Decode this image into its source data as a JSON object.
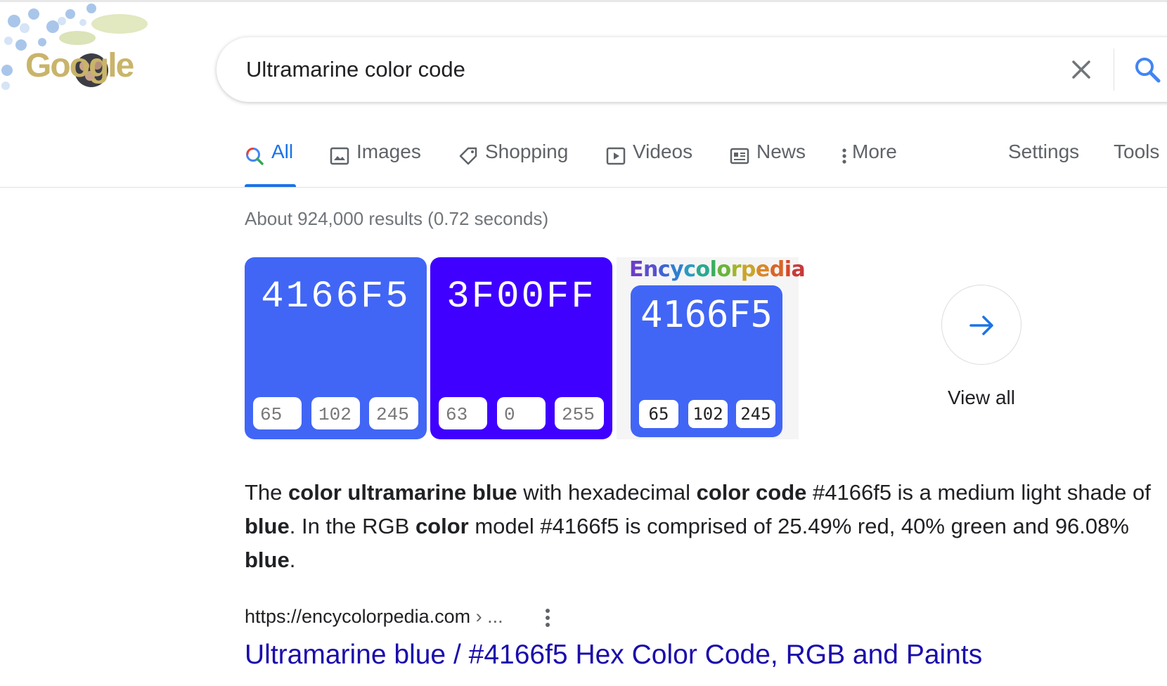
{
  "logo": {
    "text": "Google"
  },
  "search": {
    "query": "Ultramarine color code"
  },
  "tabs": [
    {
      "label": "All",
      "icon": "search-icon"
    },
    {
      "label": "Images",
      "icon": "image-icon"
    },
    {
      "label": "Shopping",
      "icon": "tag-icon"
    },
    {
      "label": "Videos",
      "icon": "play-icon"
    },
    {
      "label": "News",
      "icon": "newspaper-icon"
    },
    {
      "label": "More",
      "icon": "more-vert-icon"
    },
    {
      "label": "Settings"
    },
    {
      "label": "Tools"
    }
  ],
  "results_stats": "About 924,000 results (0.72 seconds)",
  "swatches": [
    {
      "hex": "4166F5",
      "color": "#4166F5",
      "rgb": [
        "65",
        "102",
        "245"
      ]
    },
    {
      "hex": "3F00FF",
      "color": "#3F00FF",
      "rgb": [
        "63",
        "0",
        "255"
      ]
    }
  ],
  "encycolorpedia": {
    "title": "Encycolorpedia",
    "hex": "4166F5",
    "color": "#4166F5",
    "rgb": [
      "65",
      "102",
      "245"
    ]
  },
  "view_all": "View all",
  "snippet": {
    "p1": "The ",
    "b1": "color ultramarine blue",
    "p2": " with hexadecimal ",
    "b2": "color code",
    "p3": " #4166f5 is a medium light shade of ",
    "b3": "blue",
    "p4": ". In the RGB ",
    "b4": "color",
    "p5": " model #4166f5 is comprised of 25.49% red, 40% green and 96.08% ",
    "b5": "blue",
    "p6": "."
  },
  "result": {
    "url": "https://encycolorpedia.com",
    "breadcrumb": " › ...",
    "title": "Ultramarine blue / #4166f5 Hex Color Code, RGB and Paints"
  },
  "colors": {
    "accent": "#1a73e8",
    "link": "#1a0dab",
    "muted": "#70757a"
  }
}
